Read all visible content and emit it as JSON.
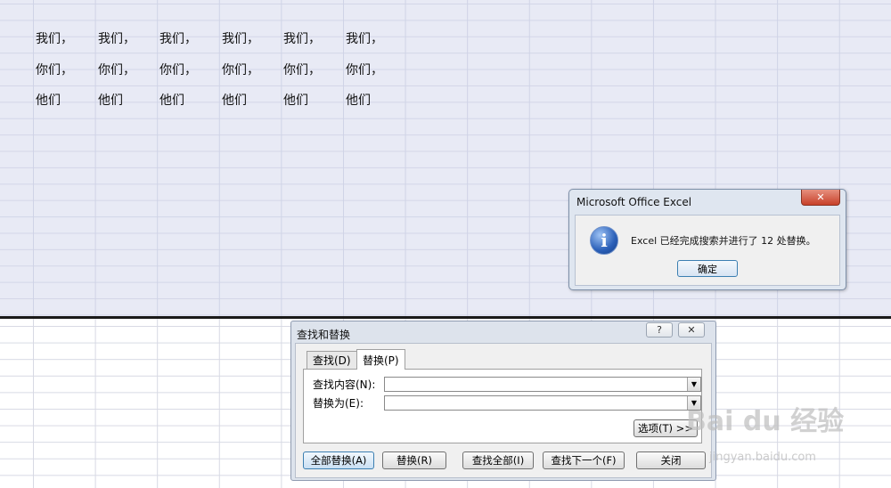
{
  "sheet": {
    "rows": [
      [
        "我们，",
        "我们，",
        "我们，",
        "我们，",
        "我们，",
        "我们，"
      ],
      [
        "你们，",
        "你们，",
        "你们，",
        "你们，",
        "你们，",
        "你们，"
      ],
      [
        "他们",
        "他们",
        "他们",
        "他们",
        "他们",
        "他们"
      ]
    ]
  },
  "message_box": {
    "title": "Microsoft Office Excel",
    "close_symbol": "✕",
    "icon": "info-icon",
    "icon_glyph": "i",
    "message": "Excel 已经完成搜索并进行了 12 处替换。",
    "ok_label": "确定"
  },
  "find_replace": {
    "title": "查找和替换",
    "help_symbol": "?",
    "close_symbol": "✕",
    "tabs": [
      {
        "label": "查找(D)",
        "active": false
      },
      {
        "label": "替换(P)",
        "active": true
      }
    ],
    "find_label": "查找内容(N):",
    "find_value": "",
    "replace_label": "替换为(E):",
    "replace_value": "",
    "options_label": "选项(T) >>",
    "buttons": {
      "replace_all": "全部替换(A)",
      "replace": "替换(R)",
      "find_all": "查找全部(I)",
      "find_next": "查找下一个(F)",
      "close": "关闭"
    }
  },
  "watermark": {
    "brand": "Bai du 经验",
    "url": "jingyan.baidu.com"
  }
}
